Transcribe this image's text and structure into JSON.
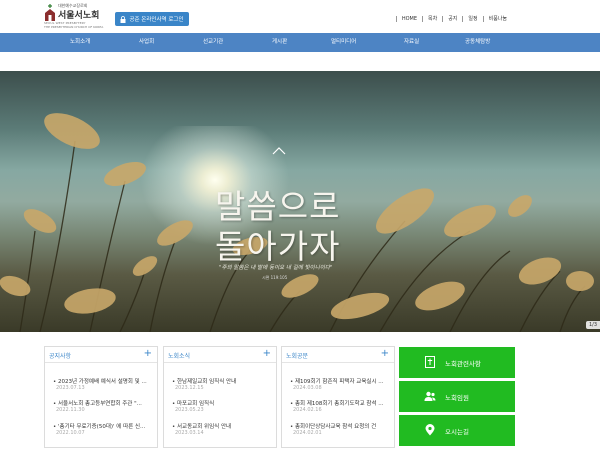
{
  "header": {
    "logo_small": "대한예수교장로회",
    "logo_main": "서울서노회",
    "logo_eng": "SEOUL WEST PRESBYTERY",
    "logo_eng2": "THE PRESBYTERIAN CHURCH OF KOREA",
    "login_label": "공준 온라인사역 로그인",
    "top_links": [
      "HOME",
      "목차",
      "공지",
      "일정",
      "비품나눔"
    ]
  },
  "nav": {
    "items": [
      "노회소개",
      "사업회",
      "선교기관",
      "게시판",
      "멀티미디어",
      "자료실",
      "공동체탐방"
    ]
  },
  "hero": {
    "title_line1": "말씀으로",
    "title_line2": "돌아가자",
    "subtitle": "\"주의 말씀은 내 발에 등이요 내 길에 빛이니이다\"",
    "subtitle2": "시편 119:105",
    "slide_counter": "1/3"
  },
  "boxes": [
    {
      "title": "공지사항",
      "posts": [
        {
          "title": "2023년 가정예배 예식서 설명회 및 ...",
          "date": "2023.07.13"
        },
        {
          "title": "서울서노회 총고등부연합회 주관 \"...",
          "date": "2022.11.30"
        },
        {
          "title": "'총기타 무료기증(50대)' 에 따른 신...",
          "date": "2022.10.07"
        }
      ]
    },
    {
      "title": "노회소식",
      "posts": [
        {
          "title": "한남제일교회 임직식 안내",
          "date": "2023.12.15"
        },
        {
          "title": "마포교회 임직식",
          "date": "2023.05.23"
        },
        {
          "title": "서교동교회 위임식 안내",
          "date": "2023.03.14"
        }
      ]
    },
    {
      "title": "노회공문",
      "posts": [
        {
          "title": "제109회기 함존직 피택자 교육실시 ...",
          "date": "2024.03.08"
        },
        {
          "title": "총회 제108회기 총회기도학교 참석 ...",
          "date": "2024.02.16"
        },
        {
          "title": "총회이단상담사교육 참석 요청의 건",
          "date": "2024.02.01"
        }
      ]
    }
  ],
  "quick_links": [
    "노회관련사항",
    "노회임원",
    "오시는길"
  ],
  "colors": {
    "nav_bg": "#4d84c4",
    "accent": "#3a85c8",
    "green": "#21bb21"
  }
}
